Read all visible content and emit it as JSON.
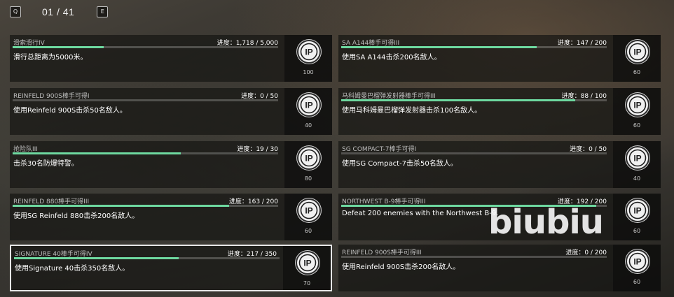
{
  "header": {
    "prev_key": "Q",
    "page_indicator": "01 / 41",
    "next_key": "E"
  },
  "cards": [
    {
      "title": "滑索滑行IV",
      "progress": "进度：1,718 / 5,000",
      "fraction": 0.3436,
      "desc": "滑行总距离为5000米。",
      "reward": "100",
      "selected": false
    },
    {
      "title": "SA A144棒手可得III",
      "progress": "进度：147 / 200",
      "fraction": 0.735,
      "desc": "使用SA A144击杀200名敌人。",
      "reward": "60",
      "selected": false
    },
    {
      "title": "REINFELD 900S棒手可得I",
      "progress": "进度：0 / 50",
      "fraction": 0.0,
      "desc": "使用Reinfeld 900S击杀50名敌人。",
      "reward": "40",
      "selected": false
    },
    {
      "title": "马科姆曼巴榴弹发射器棒手可得III",
      "progress": "进度：88 / 100",
      "fraction": 0.88,
      "desc": "使用马科姆曼巴榴弹发射器击杀100名敌人。",
      "reward": "60",
      "selected": false
    },
    {
      "title": "抢险队III",
      "progress": "进度：19 / 30",
      "fraction": 0.6333,
      "desc": "击杀30名防爆特警。",
      "reward": "80",
      "selected": false
    },
    {
      "title": "SG COMPACT-7棒手可得I",
      "progress": "进度：0 / 50",
      "fraction": 0.0,
      "desc": "使用SG Compact-7击杀50名敌人。",
      "reward": "40",
      "selected": false
    },
    {
      "title": "REINFELD 880棒手可得III",
      "progress": "进度：163 / 200",
      "fraction": 0.815,
      "desc": "使用SG Reinfeld 880击杀200名敌人。",
      "reward": "60",
      "selected": false
    },
    {
      "title": "NORTHWEST B-9棒手可得III",
      "progress": "进度：192 / 200",
      "fraction": 0.96,
      "desc": "Defeat 200 enemies with the Northwest B-9.",
      "reward": "60",
      "selected": false
    },
    {
      "title": "SIGNATURE 40棒手可得IV",
      "progress": "进度：217 / 350",
      "fraction": 0.62,
      "desc": "使用Signature 40击杀350名敌人。",
      "reward": "70",
      "selected": true
    },
    {
      "title": "REINFELD 900S棒手可得III",
      "progress": "进度：0 / 200",
      "fraction": 0.0,
      "desc": "使用Reinfeld 900S击杀200名敌人。",
      "reward": "60",
      "selected": false
    }
  ],
  "reward_icon": "ip-icon",
  "colors": {
    "progress_fill": "#6ed9a0",
    "selected_border": "#e6e6e6"
  },
  "watermark": "biubiu"
}
